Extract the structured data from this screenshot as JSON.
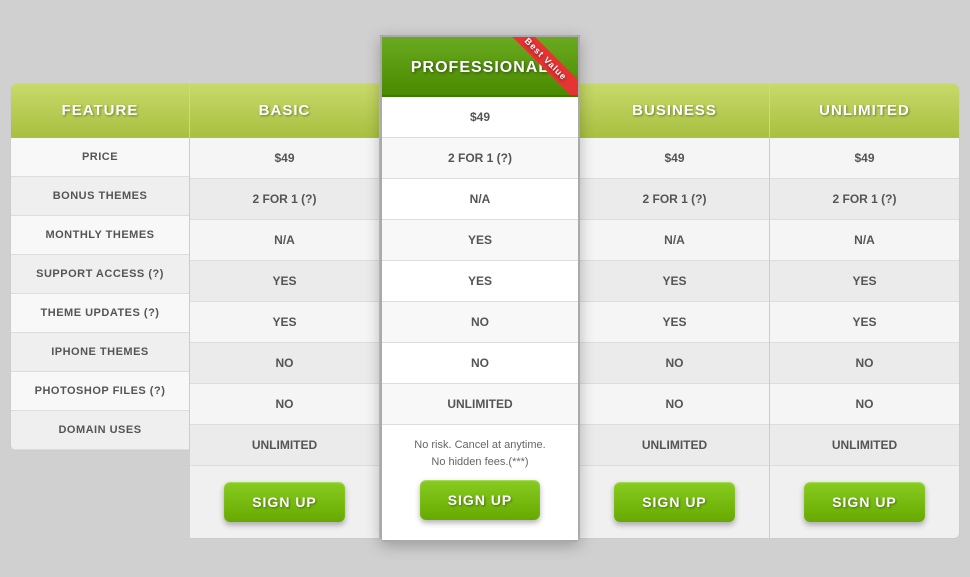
{
  "table": {
    "feature_header": "FEATURE",
    "columns": [
      {
        "id": "basic",
        "label": "BASIC",
        "featured": false
      },
      {
        "id": "professional",
        "label": "PROFESSIONAL",
        "featured": true
      },
      {
        "id": "business",
        "label": "BUSINESS",
        "featured": false
      },
      {
        "id": "unlimited",
        "label": "UNLIMITED",
        "featured": false
      }
    ],
    "rows": [
      {
        "label": "PRICE",
        "basic": "$49",
        "professional": "$49",
        "business": "$49",
        "unlimited": "$49"
      },
      {
        "label": "BONUS THEMES",
        "basic": "2 FOR 1 (?)",
        "professional": "2 FOR 1 (?)",
        "business": "2 FOR 1 (?)",
        "unlimited": "2 FOR 1 (?)"
      },
      {
        "label": "MONTHLY THEMES",
        "basic": "N/A",
        "professional": "N/A",
        "business": "N/A",
        "unlimited": "N/A"
      },
      {
        "label": "SUPPORT ACCESS (?)",
        "basic": "YES",
        "professional": "YES",
        "business": "YES",
        "unlimited": "YES",
        "yes": true
      },
      {
        "label": "THEME UPDATES (?)",
        "basic": "YES",
        "professional": "YES",
        "business": "YES",
        "unlimited": "YES",
        "yes": true
      },
      {
        "label": "IPHONE THEMES",
        "basic": "NO",
        "professional": "NO",
        "business": "NO",
        "unlimited": "NO"
      },
      {
        "label": "PHOTOSHOP FILES (?)",
        "basic": "NO",
        "professional": "NO",
        "business": "NO",
        "unlimited": "NO"
      },
      {
        "label": "DOMAIN USES",
        "basic": "UNLIMITED",
        "professional": "UNLIMITED",
        "business": "UNLIMITED",
        "unlimited": "UNLIMITED"
      }
    ],
    "best_value_label": "Best Value",
    "footer_note": "No risk. Cancel at anytime.\nNo hidden fees.(***)",
    "signup_label": "SIGN UP"
  }
}
